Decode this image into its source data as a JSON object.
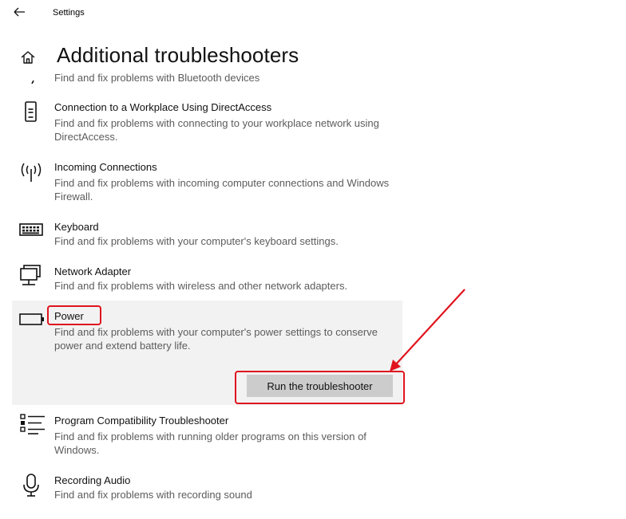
{
  "header": {
    "app_title": "Settings",
    "page_title": "Additional troubleshooters"
  },
  "partial_item": {
    "desc": "Find and fix problems with Bluetooth devices"
  },
  "items": [
    {
      "name": "Connection to a Workplace Using DirectAccess",
      "desc": "Find and fix problems with connecting to your workplace network using DirectAccess.",
      "icon": "phone-icon"
    },
    {
      "name": "Incoming Connections",
      "desc": "Find and fix problems with incoming computer connections and Windows Firewall.",
      "icon": "antenna-icon"
    },
    {
      "name": "Keyboard",
      "desc": "Find and fix problems with your computer's keyboard settings.",
      "icon": "keyboard-icon"
    },
    {
      "name": "Network Adapter",
      "desc": "Find and fix problems with wireless and other network adapters.",
      "icon": "network-adapter-icon"
    },
    {
      "name": "Power",
      "desc": "Find and fix problems with your computer's power settings to conserve power and extend battery life.",
      "icon": "battery-icon",
      "button_label": "Run the troubleshooter"
    },
    {
      "name": "Program Compatibility Troubleshooter",
      "desc": "Find and fix problems with running older programs on this version of Windows.",
      "icon": "list-icon"
    },
    {
      "name": "Recording Audio",
      "desc": "Find and fix problems with recording sound",
      "icon": "microphone-icon"
    }
  ],
  "annotation": {
    "color": "#e0141e"
  }
}
